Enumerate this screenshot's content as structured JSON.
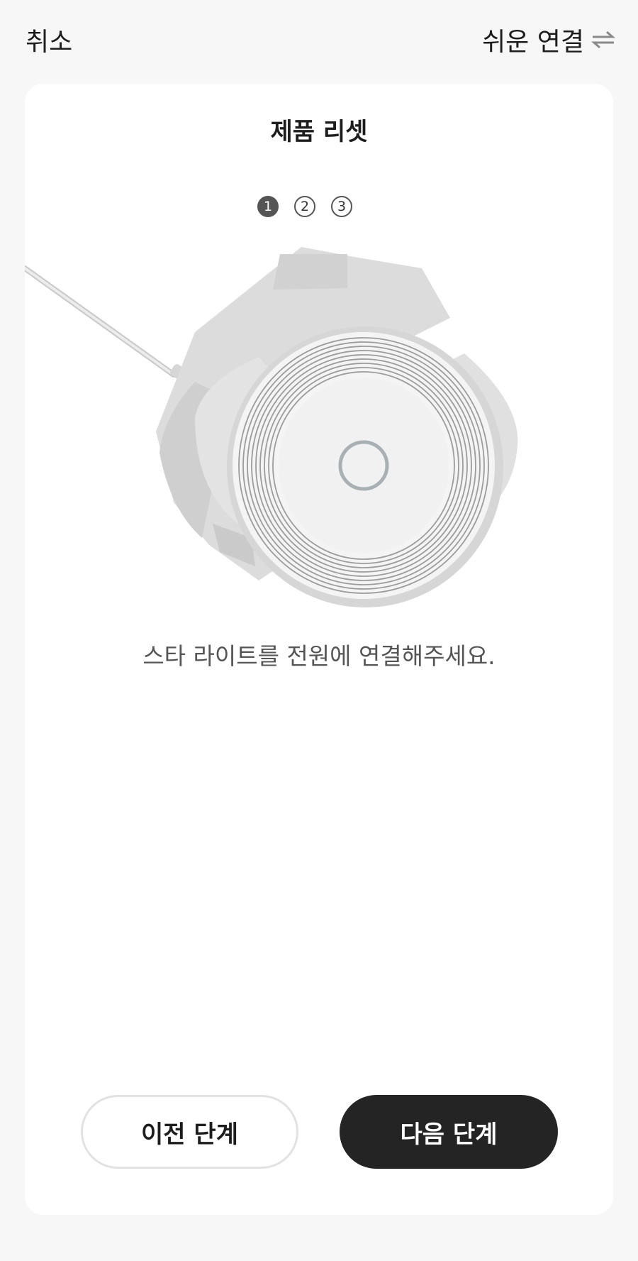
{
  "header": {
    "cancel_label": "취소",
    "easy_connect_label": "쉬운 연결",
    "easy_connect_icon": "swap-arrows-icon"
  },
  "card": {
    "title": "제품 리셋",
    "steps": [
      "1",
      "2",
      "3"
    ],
    "active_step": 1,
    "illustration": "power-connected-device-illustration",
    "instruction": "스타 라이트를 전원에 연결해주세요."
  },
  "buttons": {
    "prev_label": "이전 단계",
    "next_label": "다음 단계"
  },
  "colors": {
    "background": "#f7f7f7",
    "card": "#ffffff",
    "primary_button": "#232423",
    "step_active": "#555555"
  }
}
